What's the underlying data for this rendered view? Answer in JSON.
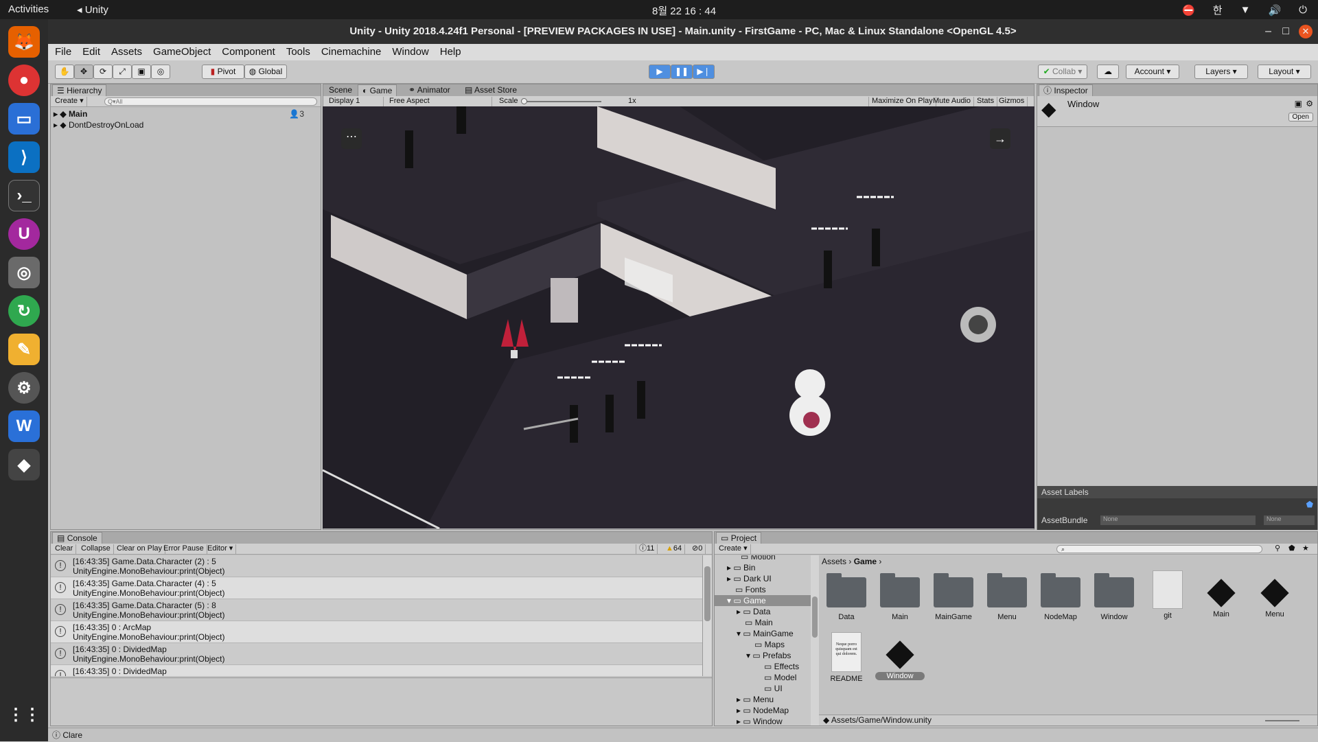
{
  "topbar": {
    "activities": "Activities",
    "app": "Unity",
    "clock": "8월 22 16 : 44",
    "lang": "한"
  },
  "title": "Unity - Unity 2018.4.24f1 Personal - [PREVIEW PACKAGES IN USE] - Main.unity - FirstGame - PC, Mac & Linux Standalone <OpenGL 4.5>",
  "menu": [
    "File",
    "Edit",
    "Assets",
    "GameObject",
    "Component",
    "Tools",
    "Cinemachine",
    "Window",
    "Help"
  ],
  "toolbar": {
    "pivot": "Pivot",
    "global": "Global",
    "collab": "Collab",
    "account": "Account",
    "layers": "Layers",
    "layout": "Layout"
  },
  "hierarchy": {
    "tab": "Hierarchy",
    "create": "Create",
    "search": "Q▾All",
    "main": "Main",
    "main_count": "3",
    "ddol": "DontDestroyOnLoad"
  },
  "view_tabs": [
    "Scene",
    "Game",
    "Animator",
    "Asset Store"
  ],
  "game_bar": {
    "display": "Display 1",
    "aspect": "Free Aspect",
    "scale_label": "Scale",
    "scale_value": "1x",
    "maximize": "Maximize On Play",
    "mute": "Mute Audio",
    "stats": "Stats",
    "gizmos": "Gizmos"
  },
  "inspector": {
    "tab": "Inspector",
    "name": "Window",
    "open": "Open",
    "asset_labels": "Asset Labels",
    "assetbundle": "AssetBundle",
    "ab_none": "None",
    "ab_none2": "None"
  },
  "console": {
    "tab": "Console",
    "buttons": [
      "Clear",
      "Collapse",
      "Clear on Play",
      "Error Pause",
      "Editor"
    ],
    "count_info": "11",
    "count_warn": "64",
    "count_err": "0",
    "rows": [
      {
        "l1": "[16:43:35] Game.Data.Character (2) : 5",
        "l2": "UnityEngine.MonoBehaviour:print(Object)"
      },
      {
        "l1": "[16:43:35] Game.Data.Character (4) : 5",
        "l2": "UnityEngine.MonoBehaviour:print(Object)"
      },
      {
        "l1": "[16:43:35] Game.Data.Character (5) : 8",
        "l2": "UnityEngine.MonoBehaviour:print(Object)"
      },
      {
        "l1": "[16:43:35] 0 : ArcMap",
        "l2": "UnityEngine.MonoBehaviour:print(Object)"
      },
      {
        "l1": "[16:43:35] 0 : DividedMap",
        "l2": "UnityEngine.MonoBehaviour:print(Object)"
      },
      {
        "l1": "[16:43:35] 0 : DividedMap",
        "l2": ""
      }
    ]
  },
  "project": {
    "tab": "Project",
    "create": "Create",
    "crumb1": "Assets",
    "crumb2": "Game",
    "tree": [
      "Motion",
      "Bin",
      "Dark UI",
      "Fonts",
      "Game",
      "Data",
      "Main",
      "MainGame",
      "Maps",
      "Prefabs",
      "Effects",
      "Model",
      "UI",
      "Menu",
      "NodeMap",
      "Window"
    ],
    "assets": [
      "Data",
      "Main",
      "MainGame",
      "Menu",
      "NodeMap",
      "Window",
      "git",
      "Main",
      "Menu",
      "README",
      "Window"
    ],
    "readme_text": "Neque porro quisquam est qui dolorem.",
    "path": "Assets/Game/Window.unity"
  },
  "status": "Clare"
}
